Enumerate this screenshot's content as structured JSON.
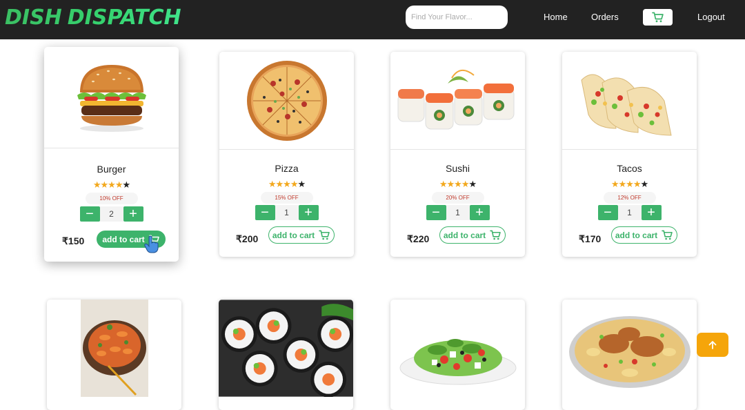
{
  "app": {
    "logo_word1": "DISH",
    "logo_word2": "DISPATCH"
  },
  "nav": {
    "search_placeholder": "Find Your Flavor...",
    "home": "Home",
    "orders": "Orders",
    "logout": "Logout"
  },
  "cards": [
    {
      "name": "Burger",
      "rating": 4,
      "discount": "10% OFF",
      "qty": "2",
      "price": "₹150",
      "add_label": "add to cart"
    },
    {
      "name": "Pizza",
      "rating": 4,
      "discount": "15% OFF",
      "qty": "1",
      "price": "₹200",
      "add_label": "add to cart"
    },
    {
      "name": "Sushi",
      "rating": 4,
      "discount": "20% OFF",
      "qty": "1",
      "price": "₹220",
      "add_label": "add to cart"
    },
    {
      "name": "Tacos",
      "rating": 4,
      "discount": "12% OFF",
      "qty": "1",
      "price": "₹170",
      "add_label": "add to cart"
    }
  ],
  "second_row_images": [
    "pasta-image",
    "sushi-rolls-image",
    "salad-image",
    "biryani-image"
  ],
  "colors": {
    "navbar": "#222222",
    "accent_green": "#3db36b",
    "star": "#f2a81d",
    "discount_text": "#c0392b",
    "scroll_button": "#f5a50a"
  },
  "icons": {
    "cart": "cart-icon",
    "minus": "minus-icon",
    "plus": "plus-icon",
    "star": "star-icon",
    "scroll_top": "arrow-up-icon",
    "cursor": "hand-cursor-icon"
  }
}
